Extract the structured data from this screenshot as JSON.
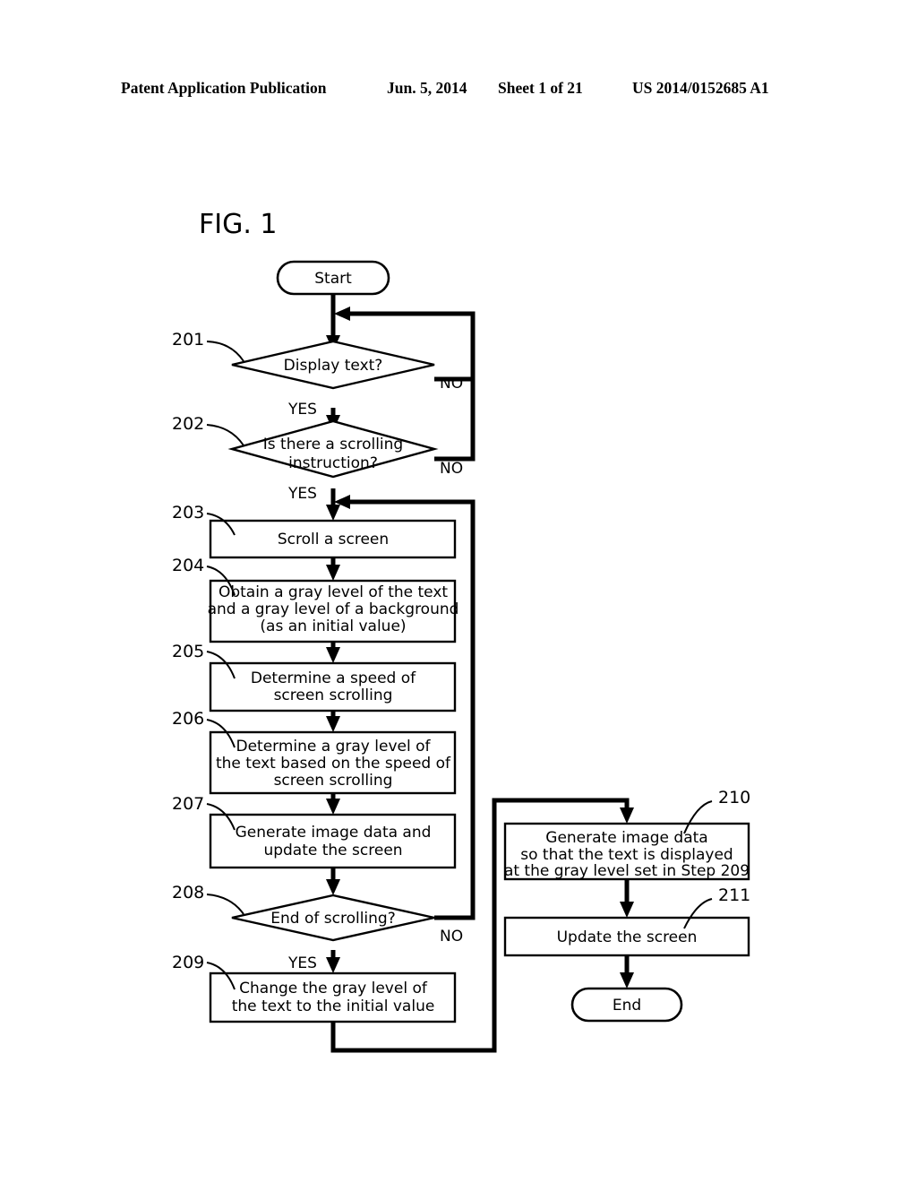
{
  "header": {
    "publication": "Patent Application Publication",
    "date": "Jun. 5, 2014",
    "sheet": "Sheet 1 of 21",
    "patent_number": "US 2014/0152685 A1"
  },
  "figure": {
    "title": "FIG. 1"
  },
  "flowchart": {
    "terminators": {
      "start": "Start",
      "end": "End"
    },
    "branch_labels": {
      "yes": "YES",
      "no": "NO"
    },
    "steps": [
      {
        "ref": "201",
        "type": "decision",
        "text": [
          "Display text?"
        ]
      },
      {
        "ref": "202",
        "type": "decision",
        "text": [
          "Is there a scrolling",
          "instruction?"
        ]
      },
      {
        "ref": "203",
        "type": "process",
        "text": [
          "Scroll a screen"
        ]
      },
      {
        "ref": "204",
        "type": "process",
        "text": [
          "Obtain a gray level of the text",
          "and a gray level of a background",
          "(as an initial value)"
        ]
      },
      {
        "ref": "205",
        "type": "process",
        "text": [
          "Determine a speed of",
          "screen scrolling"
        ]
      },
      {
        "ref": "206",
        "type": "process",
        "text": [
          "Determine a gray level of",
          "the text based on the speed of",
          "screen scrolling"
        ]
      },
      {
        "ref": "207",
        "type": "process",
        "text": [
          "Generate image data and",
          "update the screen"
        ]
      },
      {
        "ref": "208",
        "type": "decision",
        "text": [
          "End of scrolling?"
        ]
      },
      {
        "ref": "209",
        "type": "process",
        "text": [
          "Change the gray level of",
          "the text to the initial value"
        ]
      },
      {
        "ref": "210",
        "type": "process",
        "text": [
          "Generate image data",
          "so that the text is displayed",
          "at the gray level set in Step 209"
        ]
      },
      {
        "ref": "211",
        "type": "process",
        "text": [
          "Update the screen"
        ]
      }
    ],
    "branches": [
      {
        "from": "201",
        "label": "YES"
      },
      {
        "from": "201",
        "label": "NO"
      },
      {
        "from": "202",
        "label": "YES"
      },
      {
        "from": "202",
        "label": "NO"
      },
      {
        "from": "208",
        "label": "YES"
      },
      {
        "from": "208",
        "label": "NO"
      }
    ]
  },
  "colors": {
    "ink": "#000000",
    "paper": "#ffffff"
  }
}
